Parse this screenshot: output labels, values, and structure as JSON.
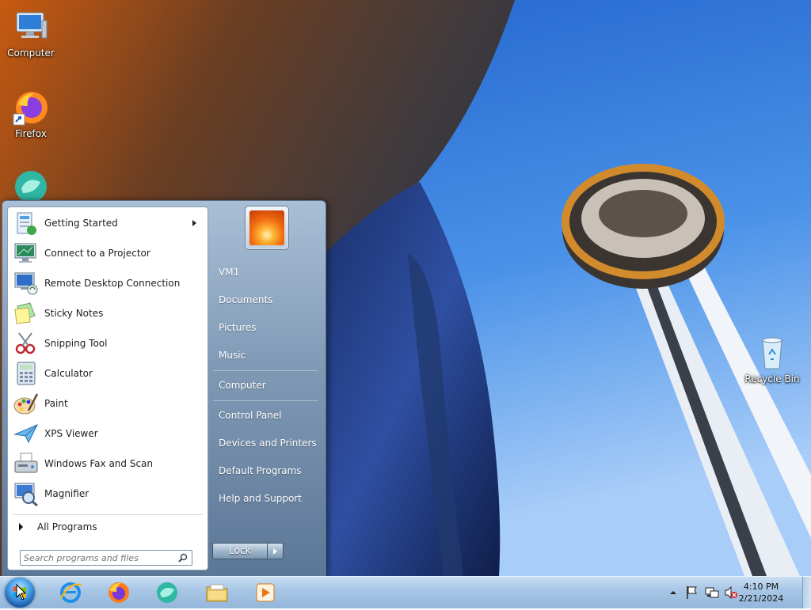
{
  "desktop": {
    "icons": [
      {
        "label": "Computer",
        "icon": "computer-icon"
      },
      {
        "label": "Firefox",
        "icon": "firefox-icon"
      },
      {
        "label": "",
        "icon": "app-icon"
      },
      {
        "label": "Recycle Bin",
        "icon": "recycle-bin-icon"
      }
    ]
  },
  "start_menu": {
    "programs": [
      {
        "label": "Getting Started",
        "icon": "getting-started-icon",
        "has_submenu": true
      },
      {
        "label": "Connect to a Projector",
        "icon": "projector-icon"
      },
      {
        "label": "Remote Desktop Connection",
        "icon": "remote-desktop-icon"
      },
      {
        "label": "Sticky Notes",
        "icon": "sticky-notes-icon"
      },
      {
        "label": "Snipping Tool",
        "icon": "snipping-tool-icon"
      },
      {
        "label": "Calculator",
        "icon": "calculator-icon"
      },
      {
        "label": "Paint",
        "icon": "paint-icon"
      },
      {
        "label": "XPS Viewer",
        "icon": "xps-viewer-icon"
      },
      {
        "label": "Windows Fax and Scan",
        "icon": "fax-scan-icon"
      },
      {
        "label": "Magnifier",
        "icon": "magnifier-icon"
      }
    ],
    "all_programs": "All Programs",
    "search_placeholder": "Search programs and files",
    "places": [
      "VM1",
      "Documents",
      "Pictures",
      "Music",
      "Computer",
      "Control Panel",
      "Devices and Printers",
      "Default Programs",
      "Help and Support"
    ],
    "lock_label": "Lock"
  },
  "taskbar": {
    "pinned": [
      "internet-explorer-icon",
      "firefox-icon",
      "app-icon",
      "file-explorer-icon",
      "media-player-icon"
    ],
    "clock_time": "4:10 PM",
    "clock_date": "2/21/2024"
  }
}
